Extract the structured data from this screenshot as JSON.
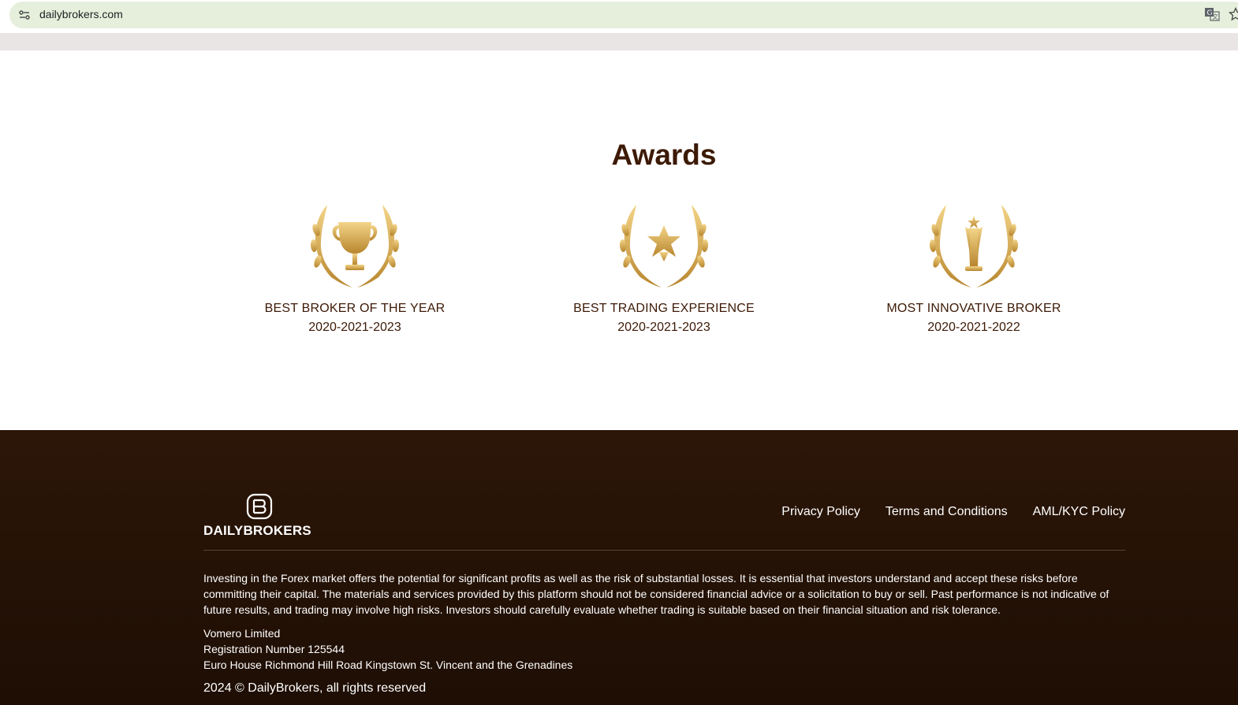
{
  "browser": {
    "url": "dailybrokers.com"
  },
  "awards": {
    "title": "Awards",
    "items": [
      {
        "name": "BEST BROKER OF THE YEAR",
        "years": "2020-2021-2023",
        "icon": "trophy-laurel-icon"
      },
      {
        "name": "BEST TRADING EXPERIENCE",
        "years": "2020-2021-2023",
        "icon": "star-laurel-icon"
      },
      {
        "name": "MOST INNOVATIVE BROKER",
        "years": "2020-2021-2022",
        "icon": "statuette-laurel-icon"
      }
    ]
  },
  "footer": {
    "logo_text": "DAILYBROKERS",
    "links": [
      "Privacy Policy",
      "Terms and Conditions",
      "AML/KYC Policy"
    ],
    "disclaimer": "Investing in the Forex market offers the potential for significant profits as well as the risk of substantial losses. It is essential that investors understand and accept these risks before committing their capital. The materials and services provided by this platform should not be considered financial advice or a solicitation to buy or sell. Past performance is not indicative of future results, and trading may involve high risks. Investors should carefully evaluate whether trading is suitable based on their financial situation and risk tolerance.",
    "company_name": "Vomero Limited",
    "registration": "Registration Number 125544",
    "address": "Euro House Richmond Hill Road Kingstown St. Vincent and the Grenadines",
    "copyright": "2024 © DailyBrokers, all rights reserved"
  },
  "colors": {
    "heading": "#3d1a06",
    "gold": "#d4a94a",
    "footer_bg": "#241206",
    "omnibox_bg": "#e6efdc"
  }
}
